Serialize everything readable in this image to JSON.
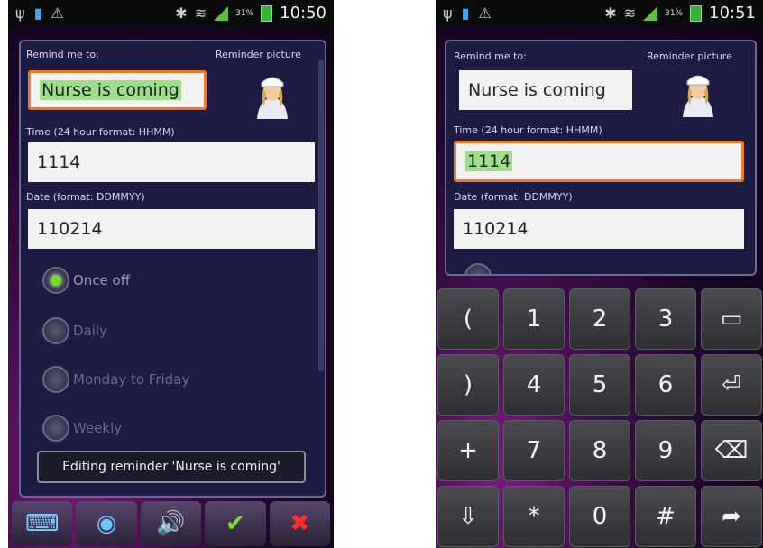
{
  "left": {
    "status": {
      "percent": "31%",
      "clock": "10:50"
    },
    "form": {
      "remind_label": "Remind me to:",
      "picture_label": "Reminder picture",
      "remind_value": "Nurse is coming",
      "time_label": "Time (24 hour format: HHMM)",
      "time_value": "1114",
      "date_label": "Date (format: DDMMYY)",
      "date_value": "110214",
      "options": [
        "Once off",
        "Daily",
        "Monday to Friday",
        "Weekly"
      ],
      "selected_option": "Once off"
    },
    "toast": "Editing reminder 'Nurse is coming'",
    "toolbar": [
      "keyboard-icon",
      "camera-icon",
      "speaker-icon",
      "check-icon",
      "close-icon"
    ]
  },
  "right": {
    "status": {
      "percent": "31%",
      "clock": "10:51"
    },
    "form": {
      "remind_label": "Remind me to:",
      "picture_label": "Reminder picture",
      "remind_value": "Nurse is coming",
      "time_label": "Time (24 hour format: HHMM)",
      "time_value": "1114",
      "date_label": "Date (format: DDMMYY)",
      "date_value": "110214"
    },
    "keypad": {
      "row1": [
        "(",
        "1",
        "2",
        "3",
        "space"
      ],
      "row2": [
        ")",
        "4",
        "5",
        "6",
        "enter"
      ],
      "row3": [
        "+",
        "7",
        "8",
        "9",
        "backspace"
      ],
      "row4": [
        "hide",
        "*",
        "0",
        "#",
        "next"
      ],
      "symbols": {
        "space": "▭",
        "enter": "⏎",
        "backspace": "⌫",
        "hide": "⇩",
        "next": "➦"
      }
    }
  },
  "colors": {
    "focus_border": "#f07a20",
    "highlight": "#9ee08a",
    "panel": "#1d1a44",
    "radio_on": "#7ad82a"
  }
}
